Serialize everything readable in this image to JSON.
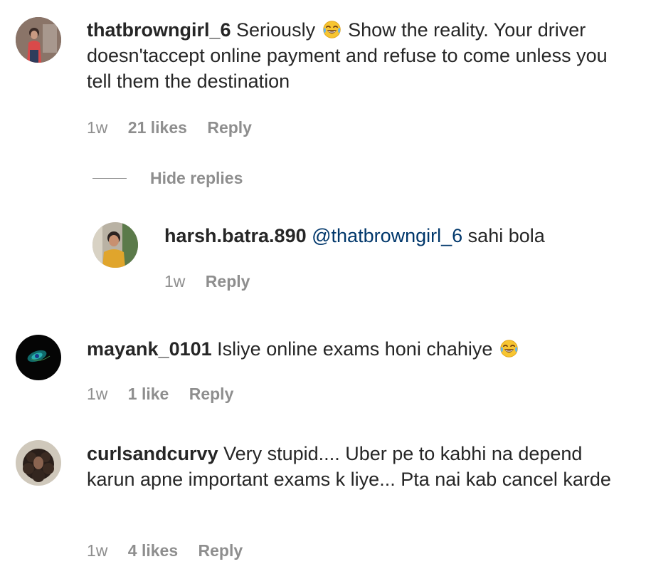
{
  "comments": [
    {
      "username": "thatbrowngirl_6",
      "text_before_emoji": "Seriously",
      "emoji": "face-with-tears-of-joy-icon",
      "text_after_emoji": "Show the reality. Your driver doesn'taccept online payment and refuse to come unless you tell them the destination",
      "time": "1w",
      "likes": "21 likes",
      "reply": "Reply"
    },
    {
      "username": "mayank_0101",
      "text": "Isliye online exams honi chahiye",
      "emoji": "face-with-tears-of-joy-icon",
      "time": "1w",
      "likes": "1 like",
      "reply": "Reply"
    },
    {
      "username": "curlsandcurvy",
      "text": "Very stupid.... Uber pe to kabhi na depend karun apne important exams k liye... Pta nai kab cancel karde",
      "time": "1w",
      "likes": "4 likes",
      "reply": "Reply"
    }
  ],
  "replies_toggle": {
    "label": "Hide replies"
  },
  "reply": {
    "username": "harsh.batra.890",
    "mention": "@thatbrowngirl_6",
    "text": "sahi bola",
    "time": "1w",
    "reply": "Reply"
  },
  "colors": {
    "text": "#262626",
    "muted": "#8e8e8e",
    "mention": "#00376b",
    "background": "#ffffff"
  }
}
